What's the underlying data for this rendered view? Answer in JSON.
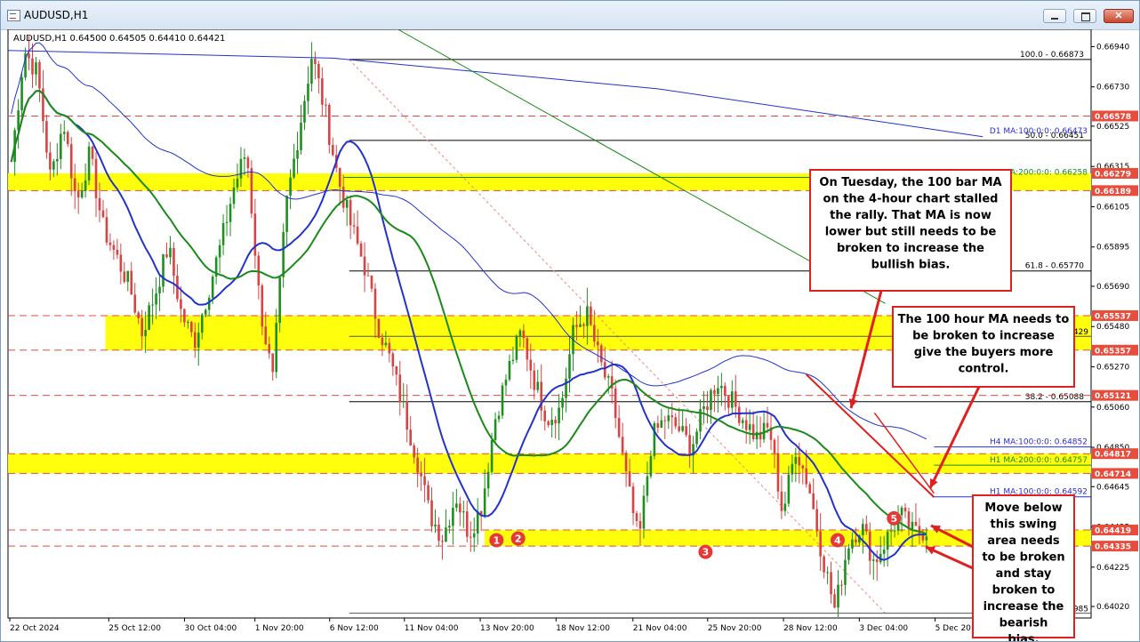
{
  "window": {
    "title": "AUDUSD,H1"
  },
  "chart_data": {
    "type": "candlestick",
    "symbol_header": "AUDUSD,H1  0.64500 0.64505 0.64410 0.64421",
    "y_range": [
      0.6396,
      0.6703
    ],
    "y_ticks": [
      "0.66940",
      "0.66730",
      "0.66525",
      "0.66315",
      "0.66105",
      "0.65895",
      "0.65690",
      "0.65480",
      "0.65270",
      "0.65060",
      "0.64850",
      "0.64645",
      "0.64435",
      "0.64225",
      "0.64020"
    ],
    "x_ticks": [
      "22 Oct 2024",
      "25 Oct 12:00",
      "30 Oct 04:00",
      "1 Nov 20:00",
      "6 Nov 12:00",
      "11 Nov 04:00",
      "13 Nov 20:00",
      "18 Nov 12:00",
      "21 Nov 04:00",
      "25 Nov 20:00",
      "28 Nov 12:00",
      "3 Dec 04:00",
      "5 Dec 20:00"
    ],
    "price_path": [
      0.6634,
      0.6692,
      0.668,
      0.6625,
      0.6655,
      0.6612,
      0.6638,
      0.66,
      0.6585,
      0.657,
      0.6545,
      0.6565,
      0.659,
      0.6555,
      0.654,
      0.6565,
      0.659,
      0.662,
      0.664,
      0.656,
      0.652,
      0.661,
      0.665,
      0.669,
      0.666,
      0.6625,
      0.66,
      0.658,
      0.655,
      0.653,
      0.6505,
      0.648,
      0.645,
      0.6438,
      0.646,
      0.644,
      0.6455,
      0.65,
      0.6525,
      0.6545,
      0.652,
      0.65,
      0.6505,
      0.6545,
      0.6555,
      0.653,
      0.651,
      0.647,
      0.6435,
      0.649,
      0.65,
      0.6495,
      0.6485,
      0.6505,
      0.652,
      0.651,
      0.65,
      0.649,
      0.6495,
      0.645,
      0.6485,
      0.6465,
      0.643,
      0.64,
      0.6435,
      0.6445,
      0.6425,
      0.6438,
      0.645,
      0.644,
      0.6442
    ],
    "h_lines": [
      {
        "price": 0.66873,
        "label": "100.0 - 0.66873",
        "color": "#000000"
      },
      {
        "price": 0.66451,
        "label": "50.0 - 0.66451",
        "color": "#000000"
      },
      {
        "price": 0.6577,
        "label": "61.8 - 0.65770",
        "color": "#000000"
      },
      {
        "price": 0.65088,
        "label": "38.2 - 0.65088",
        "color": "#000000"
      },
      {
        "price": 0.66578,
        "label": "",
        "color": "#e74c3c"
      },
      {
        "price": 0.66189,
        "label": "",
        "color": "#e74c3c"
      },
      {
        "price": 0.65537,
        "label": "",
        "color": "#e74c3c"
      },
      {
        "price": 0.65357,
        "label": "",
        "color": "#e74c3c"
      },
      {
        "price": 0.65121,
        "label": "",
        "color": "#e74c3c"
      },
      {
        "price": 0.64817,
        "label": "",
        "color": "#e74c3c"
      },
      {
        "price": 0.64714,
        "label": "",
        "color": "#e74c3c"
      },
      {
        "price": 0.64419,
        "label": "",
        "color": "#e74c3c"
      },
      {
        "price": 0.64335,
        "label": "",
        "color": "#e74c3c"
      }
    ],
    "price_tags": [
      {
        "price": 0.66578,
        "label": "0.66578"
      },
      {
        "price": 0.66279,
        "label": "0.66279"
      },
      {
        "price": 0.66189,
        "label": "0.66189"
      },
      {
        "price": 0.65537,
        "label": "0.65537"
      },
      {
        "price": 0.65357,
        "label": "0.65357"
      },
      {
        "price": 0.65121,
        "label": "0.65121"
      },
      {
        "price": 0.64817,
        "label": "0.64817"
      },
      {
        "price": 0.64714,
        "label": "0.64714"
      },
      {
        "price": 0.64419,
        "label": "0.64419"
      },
      {
        "price": 0.64335,
        "label": "0.64335"
      }
    ],
    "zones": [
      {
        "top": 0.66279,
        "bottom": 0.66189,
        "from": 0.0
      },
      {
        "top": 0.65537,
        "bottom": 0.65357,
        "from": 0.09
      },
      {
        "top": 0.64817,
        "bottom": 0.64714,
        "from": 0.0
      },
      {
        "top": 0.64419,
        "bottom": 0.64335,
        "from": 0.44
      }
    ],
    "ma_labels": [
      {
        "text": "D1 MA:100:0:0: 0.66473",
        "price": 0.66473,
        "color": "#2b2bd6"
      },
      {
        "text": "MA:200:0:0: 0.66258",
        "price": 0.66258,
        "color": "#1a8a1a"
      },
      {
        "text": "H4 MA:100:0:0: 0.64852",
        "price": 0.64852,
        "color": "#2b2bd6"
      },
      {
        "text": "H1 MA:200:0:0: 0.64757",
        "price": 0.64757,
        "color": "#1a8a1a"
      },
      {
        "text": "H1 MA:100:0:0: 0.64592",
        "price": 0.64592,
        "color": "#2b2bd6"
      }
    ],
    "partial_labels": [
      {
        "text": "429",
        "price": 0.65429
      },
      {
        "text": "985",
        "price": 0.63985
      }
    ],
    "swing_markers": [
      "1",
      "2",
      "3",
      "4",
      "5"
    ],
    "annotations": [
      {
        "text": "On Tuesday, the 100 bar MA on the 4-hour chart stalled the rally.  That MA is now lower but still needs to be broken to increase the bullish bias."
      },
      {
        "text": "The 100 hour MA needs to be broken to increase give the buyers more control."
      },
      {
        "text": "Move below this swing area needs to be broken and stay broken to increase the bearish bias."
      }
    ]
  }
}
